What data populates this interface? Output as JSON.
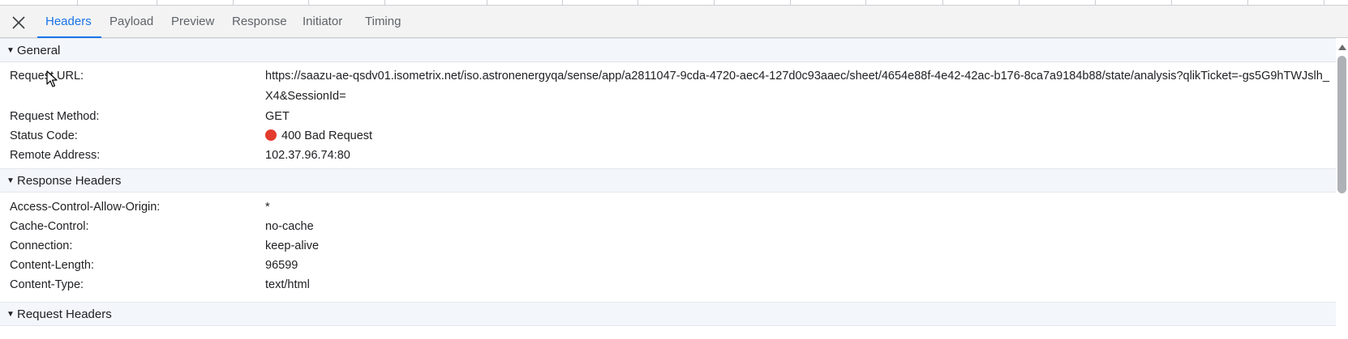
{
  "tabs": [
    {
      "label": "Headers",
      "active": true
    },
    {
      "label": "Payload",
      "active": false
    },
    {
      "label": "Preview",
      "active": false
    },
    {
      "label": "Response",
      "active": false
    },
    {
      "label": "Initiator",
      "active": false
    },
    {
      "label": "Timing",
      "active": false
    }
  ],
  "close_icon": "close-icon",
  "general": {
    "title": "General",
    "request_url_label": "Request URL:",
    "request_url_value": "https://saazu-ae-qsdv01.isometrix.net/iso.astronenergyqa/sense/app/a2811047-9cda-4720-aec4-127d0c93aaec/sheet/4654e88f-4e42-42ac-b176-8ca7a9184b88/state/analysis?qlikTicket=-gs5G9hTWJslh_X4&SessionId=",
    "request_method_label": "Request Method:",
    "request_method_value": "GET",
    "status_code_label": "Status Code:",
    "status_code_value": "400 Bad Request",
    "status_color": "#e33b2e",
    "remote_address_label": "Remote Address:",
    "remote_address_value": "102.37.96.74:80"
  },
  "response_headers": {
    "title": "Response Headers",
    "rows": [
      {
        "key": "Access-Control-Allow-Origin:",
        "value": "*"
      },
      {
        "key": "Cache-Control:",
        "value": "no-cache"
      },
      {
        "key": "Connection:",
        "value": "keep-alive"
      },
      {
        "key": "Content-Length:",
        "value": "96599"
      },
      {
        "key": "Content-Type:",
        "value": "text/html"
      }
    ]
  },
  "request_headers": {
    "title": "Request Headers"
  },
  "colors": {
    "accent": "#1a73e8",
    "section_bg": "#f3f6fb",
    "tabbar_bg": "#f3f3f3"
  }
}
